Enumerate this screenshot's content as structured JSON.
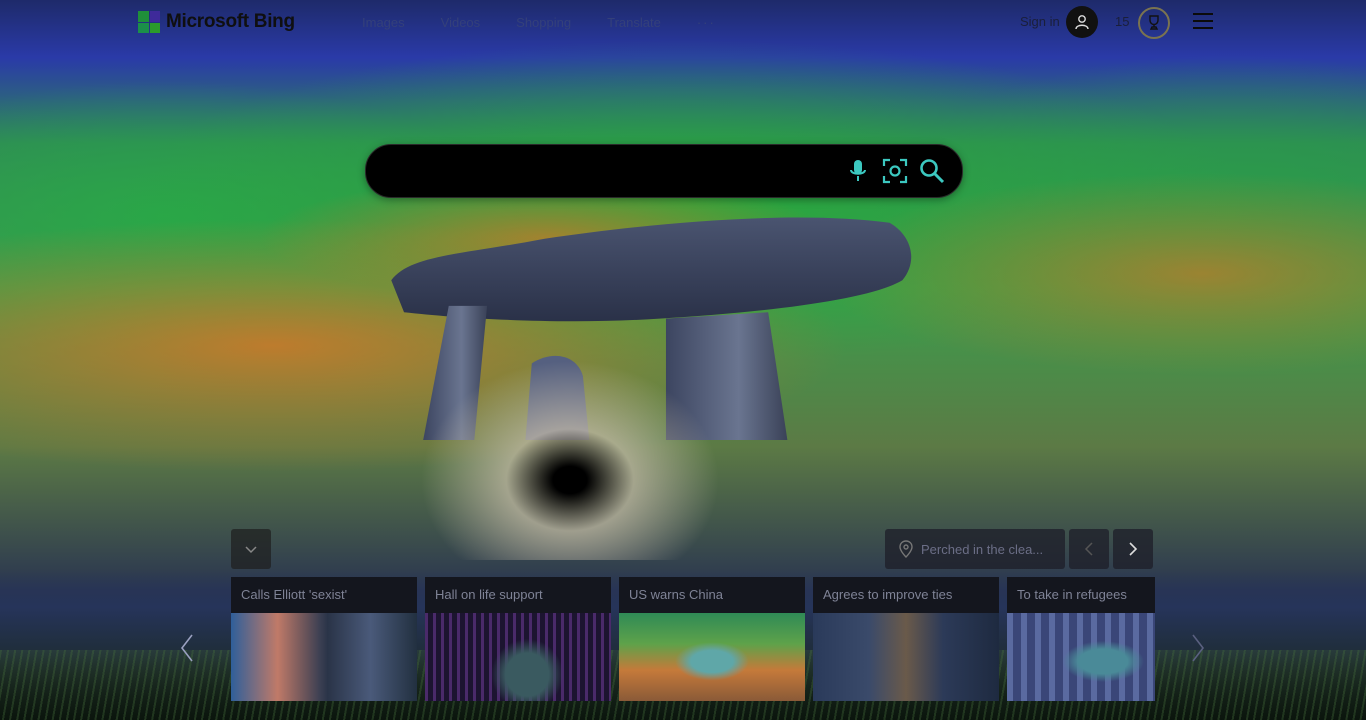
{
  "header": {
    "brand": "Microsoft Bing",
    "nav": [
      "Images",
      "Videos",
      "Shopping",
      "Translate",
      "···"
    ],
    "sign_in": "Sign in",
    "points": "15"
  },
  "search": {
    "placeholder": "",
    "value": ""
  },
  "bottom": {
    "location_label": "Perched in the clea...",
    "cards": [
      {
        "caption": "Calls Elliott 'sexist'"
      },
      {
        "caption": "Hall on life support"
      },
      {
        "caption": "US warns China"
      },
      {
        "caption": "Agrees to improve ties"
      },
      {
        "caption": "To take in refugees"
      }
    ]
  },
  "colors": {
    "logo_tl": "#1f8f3a",
    "logo_tr": "#3e2a9a",
    "logo_bl": "#1b8f4a",
    "logo_br": "#2b9a2b",
    "nav_text": "#34407a",
    "search_bg": "#000000"
  },
  "icons": {
    "mic": "mic-icon",
    "visual_search": "camera-search-icon",
    "search": "search-icon",
    "avatar": "user-icon",
    "reward": "trophy-icon",
    "menu": "hamburger-menu-icon",
    "location": "location-pin-icon"
  }
}
